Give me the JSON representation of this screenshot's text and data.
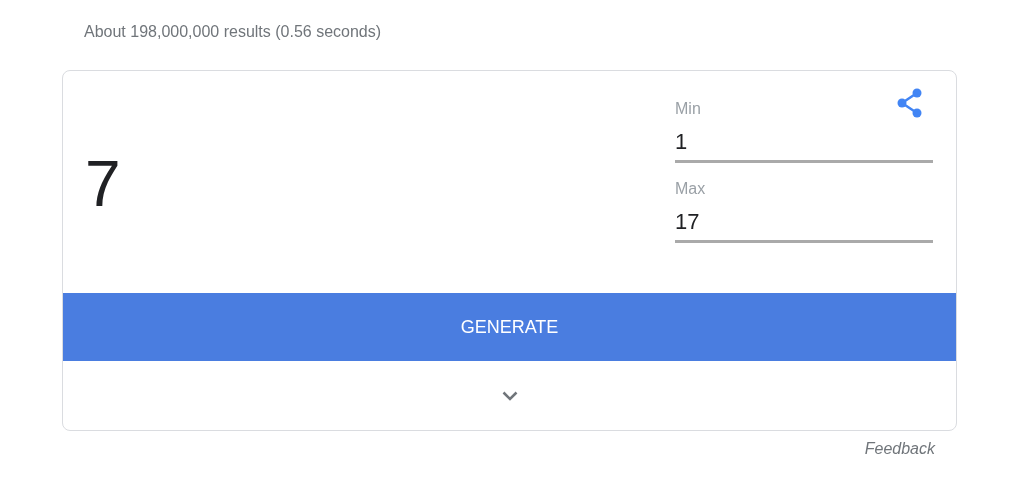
{
  "result_stats": "About 198,000,000 results (0.56 seconds)",
  "generator": {
    "result": "7",
    "fields": [
      {
        "label": "Min",
        "value": "1"
      },
      {
        "label": "Max",
        "value": "17"
      }
    ],
    "button": "GENERATE"
  },
  "feedback": "Feedback"
}
